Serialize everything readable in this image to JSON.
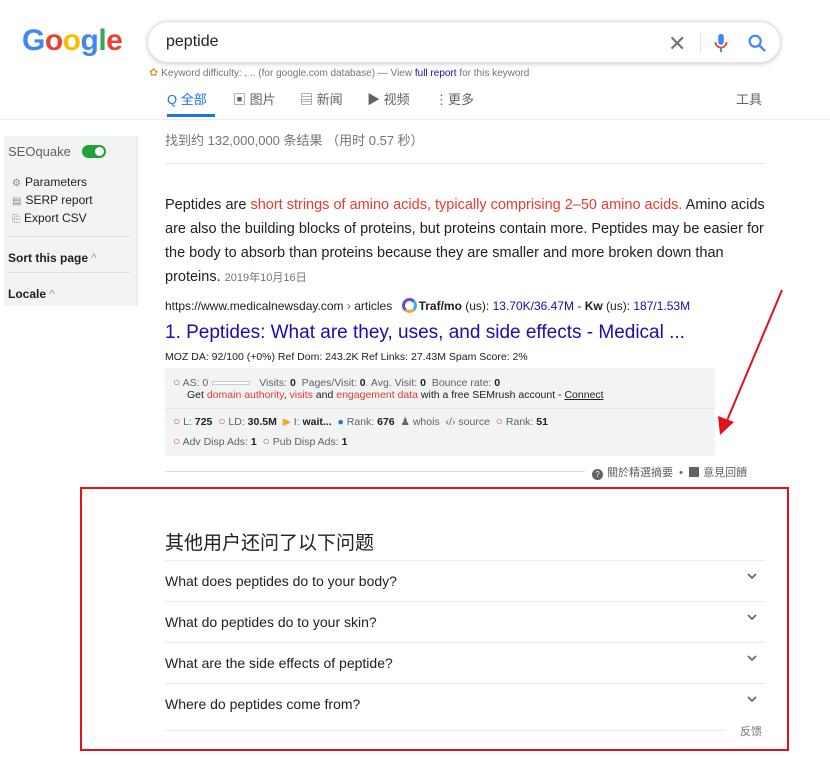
{
  "logo": {
    "text": "Google"
  },
  "search": {
    "value": "peptide",
    "clear_icon": "close-icon",
    "mic_icon": "mic-icon",
    "search_icon": "search-icon"
  },
  "keyword_difficulty": {
    "prefix": "Keyword difficulty: , .. (for google.com database) — View ",
    "link": "full report",
    "suffix": " for this keyword"
  },
  "tabs": [
    {
      "icon": "Q",
      "label": "全部",
      "active": true
    },
    {
      "icon": "▣",
      "label": "图片"
    },
    {
      "icon": "▤",
      "label": "新闻"
    },
    {
      "icon": "▶",
      "label": "视频"
    },
    {
      "icon": "⋮",
      "label": "更多"
    }
  ],
  "tools_label": "工具",
  "sidebar": {
    "title": "SEOquake",
    "links": [
      {
        "icon": "gear-icon",
        "label": "Parameters"
      },
      {
        "icon": "report-icon",
        "label": "SERP report"
      },
      {
        "icon": "export-icon",
        "label": "Export CSV"
      }
    ],
    "sort_label": "Sort this page",
    "locale_label": "Locale"
  },
  "result_stats": "找到约 132,000,000 条结果 （用时 0.57 秒）",
  "featured_snippet": {
    "text_before": "Peptides are ",
    "highlight": "short strings of amino acids, typically comprising 2–50 amino acids.",
    "text_after": " Amino acids are also the building blocks of proteins, but proteins contain more. Peptides may be easier for the body to absorb than proteins because they are smaller and more broken down than proteins.",
    "date": "2019年10月16日"
  },
  "result": {
    "url": "https://www.medicalnewsday.com",
    "breadcrumb": "articles",
    "traffic_label": "Traf/mo",
    "traffic_region": "(us):",
    "traffic_value": "13.70K/36.47M",
    "kw_label": "Kw",
    "kw_region": "(us):",
    "kw_value": "187/1.53M",
    "title": "1. Peptides: What are they, uses, and side effects - Medical ...",
    "moz": "MOZ DA: 92/100 (+0%)   Ref Dom: 243.2K   Ref Links: 27.43M   Spam Score: 2%"
  },
  "seo_box": {
    "as_label": "AS: 0",
    "visits": "Visits: ",
    "visits_val": "0",
    "pages": "Pages/Visit: ",
    "pages_val": "0",
    "avg": "Avg. Visit: ",
    "avg_val": "0",
    "bounce": "Bounce rate: ",
    "bounce_val": "0",
    "get_text": "Get ",
    "da_link": "domain authority",
    "comma": ", ",
    "visits_link": "visits",
    "and": " and ",
    "eng_link": "engagement data",
    "with_text": " with a free SEMrush account - ",
    "connect": "Connect",
    "l_label": "L: ",
    "l_val": "725",
    "ld_label": "LD: ",
    "ld_val": "30.5M",
    "i_label": "I: ",
    "i_val": "wait...",
    "rank_label": "Rank: ",
    "rank_val": "676",
    "whois": "whois",
    "source": "source",
    "rank2_label": "Rank: ",
    "rank2_val": "51",
    "adv_label": "Adv Disp Ads: ",
    "adv_val": "1",
    "pub_label": "Pub Disp Ads: ",
    "pub_val": "1"
  },
  "snippet_footer": {
    "about": "關於精選摘要",
    "dot": "•",
    "feedback": "意見回饋"
  },
  "paa": {
    "title": "其他用户还问了以下问题",
    "questions": [
      "What does peptides do to your body?",
      "What do peptides do to your skin?",
      "What are the side effects of peptide?",
      "Where do peptides come from?"
    ],
    "feedback": "反馈"
  },
  "colors": {
    "accent_blue": "#1a73e8",
    "link": "#1a0dab",
    "highlight": "#e63b2e",
    "annotation_red": "#e0121f"
  }
}
